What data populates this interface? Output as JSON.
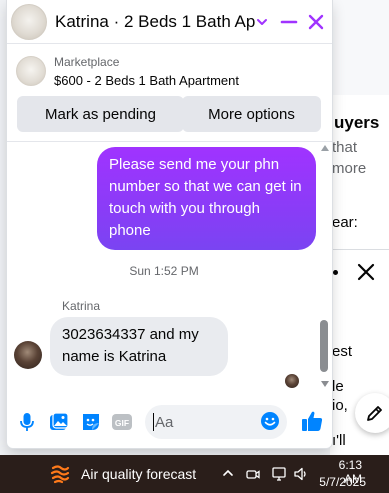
{
  "background_page": {
    "card_title": "uyers",
    "card_line1": "that",
    "card_line2": "more",
    "card_line3": "ear:",
    "list_text1": "est",
    "list_text2": "le",
    "list_text3": "io,",
    "list_text4": "ı'll"
  },
  "chat": {
    "header": {
      "title": "Katrina · 2 Beds 1 Bath Apa...",
      "chevron_icon": "chevron-down-icon",
      "minimize_icon": "minimize-icon",
      "close_icon": "close-icon"
    },
    "listing": {
      "category": "Marketplace",
      "title": "$600 - 2 Beds 1 Bath Apartment",
      "buttons": {
        "mark_pending": "Mark as pending",
        "more_options": "More options"
      }
    },
    "thread": {
      "outgoing_message": "Please send me your phn number so that we can get in touch with you through phone",
      "timestamp": "Sun 1:52 PM",
      "sender_name": "Katrina",
      "incoming_message": "3023634337 and my name is Katrina"
    },
    "composer": {
      "placeholder": "Aa",
      "icons": [
        "microphone-icon",
        "photo-icon",
        "sticker-icon",
        "gif-icon",
        "emoji-icon",
        "like-icon"
      ]
    }
  },
  "taskbar": {
    "weather_label": "Air quality forecast",
    "time": "6:13 AM",
    "date": "5/7/2025"
  },
  "colors": {
    "accent_purple": "#a033ff",
    "messenger_blue": "#0084ff",
    "incoming_bubble": "#e9ebef",
    "taskbar": "#2a1e1a"
  }
}
